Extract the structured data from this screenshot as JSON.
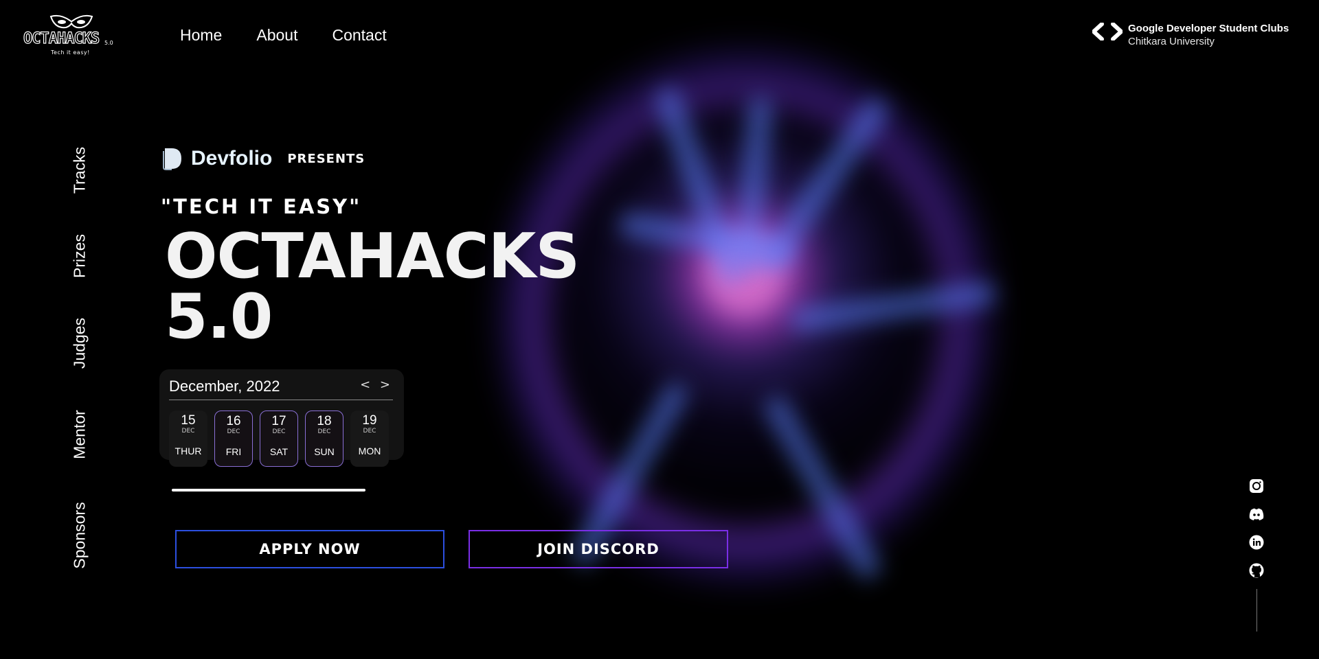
{
  "logo": {
    "text": "OCTAHACKS",
    "version": "5.0",
    "tagline": "Tech it easy!"
  },
  "nav": {
    "items": [
      "Home",
      "About",
      "Contact"
    ]
  },
  "partner": {
    "name": "Google Developer Student Clubs",
    "university": "Chitkara University"
  },
  "side_nav": [
    "Tracks",
    "Prizes",
    "Judges",
    "Mentor",
    "Sponsors"
  ],
  "hero": {
    "presenter": "Devfolio",
    "presents": "PRESENTS",
    "tagline": "\"TECH IT EASY\"",
    "title_line1": "OCTAHACKS",
    "title_line2": "5.0"
  },
  "calendar": {
    "month": "December, 2022",
    "arrows": "< >",
    "days": [
      {
        "num": "15",
        "mon": "DEC",
        "dow": "THUR",
        "active": false
      },
      {
        "num": "16",
        "mon": "DEC",
        "dow": "FRI",
        "active": true
      },
      {
        "num": "17",
        "mon": "DEC",
        "dow": "SAT",
        "active": true
      },
      {
        "num": "18",
        "mon": "DEC",
        "dow": "SUN",
        "active": true
      },
      {
        "num": "19",
        "mon": "DEC",
        "dow": "MON",
        "active": false
      }
    ]
  },
  "buttons": {
    "apply": "APPLY NOW",
    "discord": "JOIN DISCORD"
  },
  "socials": [
    "instagram-icon",
    "discord-icon",
    "linkedin-icon",
    "github-icon"
  ],
  "colors": {
    "apply_border": "#2c4fe0",
    "discord_border": "#7a2ee6",
    "active_day_border": "#8a6fd6"
  }
}
